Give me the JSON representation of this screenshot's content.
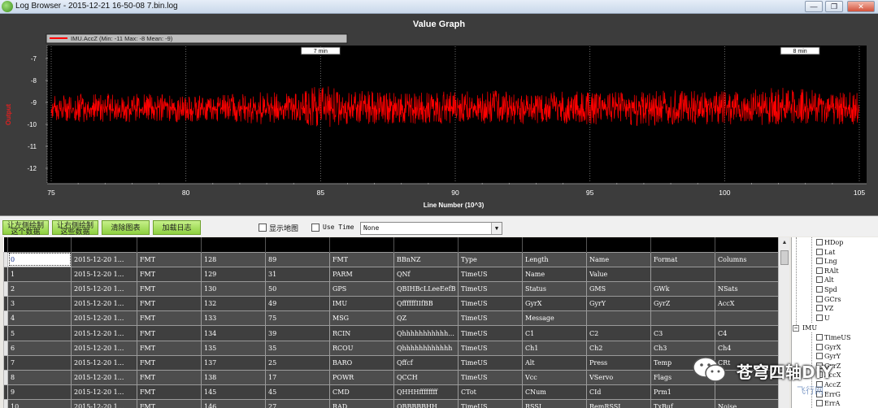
{
  "window": {
    "title": "Log Browser - 2015-12-21 16-50-08 7.bin.log",
    "controls": {
      "minimize": "—",
      "maximize": "❐",
      "close": "✕"
    }
  },
  "graph": {
    "title": "Value Graph",
    "legend": "IMU.AccZ (Min: -11 Max: -8 Mean: -9)",
    "line_color": "#ff0000",
    "background": "#000000",
    "ylabel": "Output",
    "xlabel": "Line Number (10^3)",
    "xticks": [
      "75",
      "80",
      "85",
      "90",
      "95",
      "100",
      "105"
    ],
    "yticks": [
      "-7",
      "-8",
      "-9",
      "-10",
      "-11",
      "-12"
    ],
    "time_markers": [
      "7 min",
      "8 min"
    ]
  },
  "chart_data": {
    "type": "line",
    "title": "Value Graph",
    "xlabel": "Line Number (10^3)",
    "ylabel": "Output",
    "xlim": [
      75,
      105
    ],
    "ylim": [
      -12.5,
      -6.5
    ],
    "grid": true,
    "legend_position": "top-left",
    "series": [
      {
        "name": "IMU.AccZ (Min: -11 Max: -8 Mean: -9)",
        "x": [
          75,
          76,
          77,
          78,
          79,
          80,
          81,
          82,
          83,
          84,
          85,
          86,
          87,
          88,
          89,
          90,
          91,
          92,
          93,
          94,
          95,
          96,
          97,
          98,
          99,
          100,
          101,
          102,
          103,
          104,
          105
        ],
        "y": [
          -9.2,
          -9.3,
          -9.2,
          -9.3,
          -9.2,
          -9.3,
          -9.3,
          -9.2,
          -9.3,
          -9.3,
          -9.2,
          -9.2,
          -9.3,
          -9.2,
          -9.3,
          -9.2,
          -9.3,
          -9.2,
          -9.3,
          -9.2,
          -9.3,
          -9.2,
          -9.3,
          -9.2,
          -9.3,
          -9.2,
          -9.3,
          -9.2,
          -9.3,
          -9.2,
          -9.3
        ],
        "band_low": [
          -9.8,
          -9.9,
          -9.9,
          -9.9,
          -9.9,
          -9.9,
          -9.9,
          -10,
          -10,
          -10,
          -10.2,
          -10.1,
          -10,
          -10,
          -10,
          -10,
          -10,
          -10,
          -10,
          -10,
          -10,
          -10,
          -10.1,
          -10,
          -10,
          -10,
          -10,
          -10.1,
          -10,
          -10,
          -10
        ],
        "band_high": [
          -8.7,
          -8.6,
          -8.6,
          -8.6,
          -8.6,
          -8.7,
          -8.6,
          -8.6,
          -8.5,
          -8.6,
          -8.2,
          -8.4,
          -8.5,
          -8.6,
          -8.5,
          -8.5,
          -8.5,
          -8.4,
          -8.5,
          -8.5,
          -8.5,
          -8.5,
          -8.5,
          -8.4,
          -8.4,
          -8.5,
          -8.4,
          -8.3,
          -8.4,
          -8.5,
          -8.5
        ]
      }
    ],
    "annotations": [
      {
        "text": "7 min",
        "x": 85
      },
      {
        "text": "8 min",
        "x": 102.8
      }
    ]
  },
  "toolbar": {
    "btn1": [
      "让左侧绘制",
      "这个数据"
    ],
    "btn2": [
      "让右侧绘制",
      "这些数据"
    ],
    "btn_clear": "清除图表",
    "btn_load": "加载日志",
    "map_label": "显示地图",
    "usetime_label": "Use Time",
    "select_value": "None"
  },
  "table": {
    "rows": [
      [
        "0",
        "2015-12-20 1...",
        "FMT",
        "128",
        "89",
        "FMT",
        "BBnNZ",
        "Type",
        "Length",
        "Name",
        "Format",
        "Columns"
      ],
      [
        "1",
        "2015-12-20 1...",
        "FMT",
        "129",
        "31",
        "PARM",
        "QNf",
        "TimeUS",
        "Name",
        "Value",
        "",
        ""
      ],
      [
        "2",
        "2015-12-20 1...",
        "FMT",
        "130",
        "50",
        "GPS",
        "QBIHBcLLeeEefB",
        "TimeUS",
        "Status",
        "GMS",
        "GWk",
        "NSats"
      ],
      [
        "3",
        "2015-12-20 1...",
        "FMT",
        "132",
        "49",
        "IMU",
        "QffffffIIfBB",
        "TimeUS",
        "GyrX",
        "GyrY",
        "GyrZ",
        "AccX"
      ],
      [
        "4",
        "2015-12-20 1...",
        "FMT",
        "133",
        "75",
        "MSG",
        "QZ",
        "TimeUS",
        "Message",
        "",
        "",
        ""
      ],
      [
        "5",
        "2015-12-20 1...",
        "FMT",
        "134",
        "39",
        "RCIN",
        "Qhhhhhhhhhhh...",
        "TimeUS",
        "C1",
        "C2",
        "C3",
        "C4"
      ],
      [
        "6",
        "2015-12-20 1...",
        "FMT",
        "135",
        "35",
        "RCOU",
        "Qhhhhhhhhhhhh",
        "TimeUS",
        "Ch1",
        "Ch2",
        "Ch3",
        "Ch4"
      ],
      [
        "7",
        "2015-12-20 1...",
        "FMT",
        "137",
        "25",
        "BARO",
        "Qffcf",
        "TimeUS",
        "Alt",
        "Press",
        "Temp",
        "CRt"
      ],
      [
        "8",
        "2015-12-20 1...",
        "FMT",
        "138",
        "17",
        "POWR",
        "QCCH",
        "TimeUS",
        "Vcc",
        "VServo",
        "Flags",
        ""
      ],
      [
        "9",
        "2015-12-20 1...",
        "FMT",
        "145",
        "45",
        "CMD",
        "QHHHffffffff",
        "CTot",
        "CNum",
        "CId",
        "Prm1",
        ""
      ],
      [
        "10",
        "2015-12-20 1...",
        "FMT",
        "146",
        "27",
        "RAD",
        "QBBBBBHH",
        "TimeUS",
        "RSSI",
        "RemRSSI",
        "TxBuf",
        "Noise"
      ]
    ]
  },
  "tree": {
    "items_top": [
      "HDop",
      "Lat",
      "Lng",
      "RAlt",
      "Alt",
      "Spd",
      "GCrs",
      "VZ",
      "U"
    ],
    "group": "IMU",
    "items_imu": [
      "TimeUS",
      "GyrX",
      "GyrY",
      "GyrZ",
      "AccX",
      "AccZ",
      "ErrG",
      "ErrA"
    ]
  },
  "watermark": {
    "text": "苍穹四轴DIY",
    "site": "飞行网"
  }
}
